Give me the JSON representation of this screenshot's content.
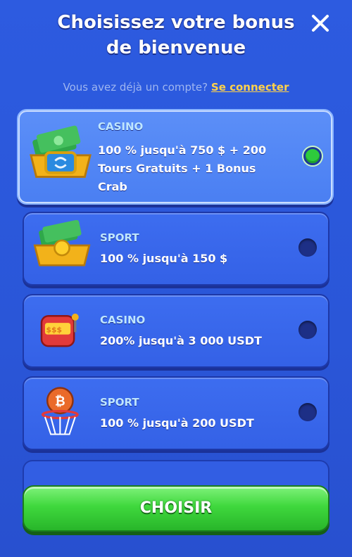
{
  "header": {
    "title": "Choisissez votre bonus de bienvenue",
    "login_prompt": "Vous avez déjà un compte?",
    "login_link": "Se connecter"
  },
  "offers": [
    {
      "category": "CASINO",
      "description": "100 % jusqu'à 750 $ + 200 Tours Gratuits + 1 Bonus Crab",
      "selected": true,
      "icon": "cash-chest-icon"
    },
    {
      "category": "SPORT",
      "description": "100 % jusqu'à 150 $",
      "selected": false,
      "icon": "cash-coin-chest-icon"
    },
    {
      "category": "CASINO",
      "description": "200% jusqu'à 3 000 USDT",
      "selected": false,
      "icon": "slot-machine-icon"
    },
    {
      "category": "SPORT",
      "description": "100 % jusqu'à 200 USDT",
      "selected": false,
      "icon": "basketball-hoop-icon"
    }
  ],
  "footer": {
    "button_label": "CHOISIR"
  },
  "colors": {
    "background": "#2d5be0",
    "accent_green": "#3fd83d",
    "link_yellow": "#ffd24a"
  }
}
